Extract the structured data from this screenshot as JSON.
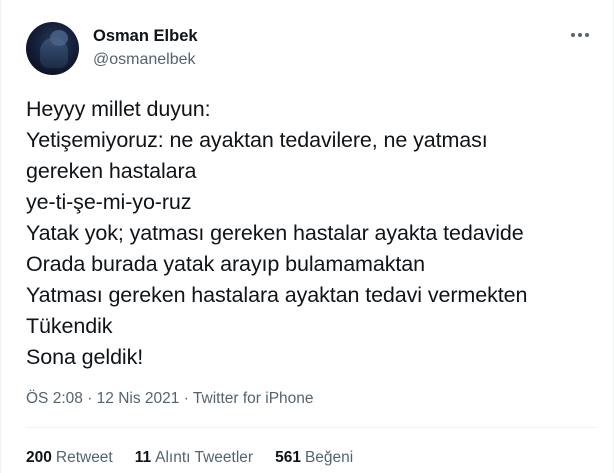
{
  "author": {
    "display_name": "Osman Elbek",
    "handle": "@osmanelbek"
  },
  "icons": {
    "more": "more-horizontal-icon"
  },
  "tweet": {
    "lines": [
      "Heyyy millet duyun:",
      "Yetişemiyoruz: ne ayaktan tedavilere, ne yatması",
      "gereken hastalara",
      "ye-ti-şe-mi-yo-ruz",
      "Yatak yok; yatması gereken hastalar ayakta tedavide",
      "Orada burada yatak arayıp bulamamaktan",
      "Yatması gereken hastalara ayaktan tedavi vermekten",
      "Tükendik",
      "Sona geldik!"
    ],
    "time": "ÖS 2:08",
    "date": "12 Nis 2021",
    "source": "Twitter for iPhone",
    "separator": "·"
  },
  "stats": {
    "retweets": {
      "count": "200",
      "label": "Retweet"
    },
    "quotes": {
      "count": "11",
      "label": "Alıntı Tweetler"
    },
    "likes": {
      "count": "561",
      "label": "Beğeni"
    }
  },
  "colors": {
    "text": "#0f1419",
    "secondary": "#536471",
    "divider": "#eff3f4"
  }
}
